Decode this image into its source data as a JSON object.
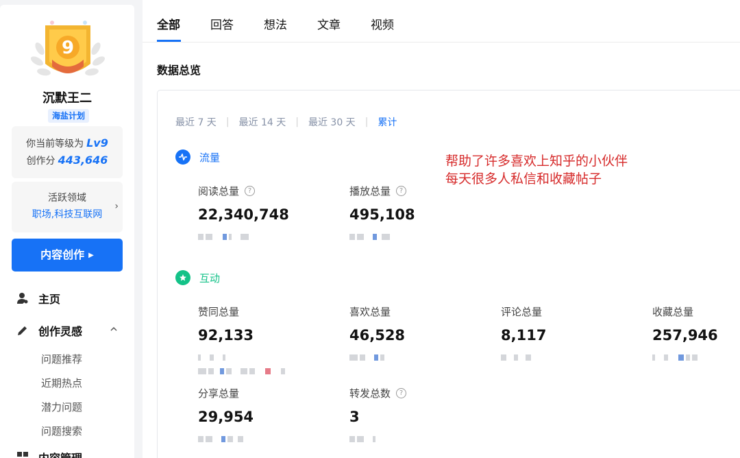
{
  "profile": {
    "level_badge": "9",
    "username": "沉默王二",
    "plan_tag": "海盐计划",
    "level_prefix": "你当前等级为",
    "level_value": "Lv9",
    "score_prefix": "创作分",
    "score_value": "443,646",
    "domain_title": "活跃领域",
    "domain_value": "职场,科技互联网"
  },
  "sidebar": {
    "create_button": "内容创作",
    "nav": [
      {
        "label": "主页",
        "icon": "user-icon"
      },
      {
        "label": "创作灵感",
        "icon": "pencil-icon"
      },
      {
        "label": "内容管理",
        "icon": "grid-icon"
      }
    ],
    "sub_items": [
      "问题推荐",
      "近期热点",
      "潜力问题",
      "问题搜索"
    ]
  },
  "tabs": [
    "全部",
    "回答",
    "想法",
    "文章",
    "视频"
  ],
  "active_tab": "全部",
  "section_title": "数据总览",
  "ranges": [
    "最近 7 天",
    "最近 14 天",
    "最近 30 天",
    "累计"
  ],
  "active_range": "累计",
  "categories": {
    "traffic": {
      "label": "流量",
      "color": "#1772f6",
      "icon": "pulse-icon"
    },
    "interaction": {
      "label": "互动",
      "color": "#13c288",
      "icon": "star-icon"
    }
  },
  "metrics": {
    "reads": {
      "label": "阅读总量",
      "value": "22,340,748"
    },
    "plays": {
      "label": "播放总量",
      "value": "495,108"
    },
    "likes": {
      "label": "赞同总量",
      "value": "92,133"
    },
    "favs": {
      "label": "喜欢总量",
      "value": "46,528"
    },
    "comments": {
      "label": "评论总量",
      "value": "8,117"
    },
    "collects": {
      "label": "收藏总量",
      "value": "257,946"
    },
    "shares": {
      "label": "分享总量",
      "value": "29,954"
    },
    "forwards": {
      "label": "转发总数",
      "value": "3"
    }
  },
  "annotation": {
    "line1": "帮助了许多喜欢上知乎的小伙伴",
    "line2": "每天很多人私信和收藏帖子"
  },
  "colors": {
    "accent": "#1772f6",
    "annotation": "#d62a2a",
    "badge": "#f3b531"
  }
}
